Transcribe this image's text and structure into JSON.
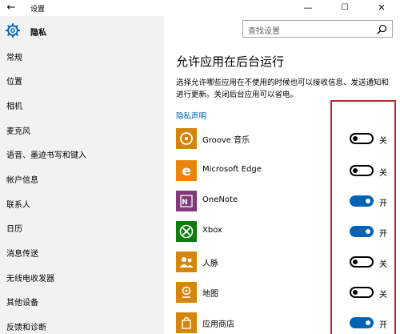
{
  "window": {
    "title": "设置",
    "back_icon": "back-arrow-icon"
  },
  "sidebar": {
    "header_label": "隐私",
    "items": [
      {
        "label": "常规"
      },
      {
        "label": "位置"
      },
      {
        "label": "相机"
      },
      {
        "label": "麦克风"
      },
      {
        "label": "语音、墨迹书写和键入"
      },
      {
        "label": "帐户信息"
      },
      {
        "label": "联系人"
      },
      {
        "label": "日历"
      },
      {
        "label": "消息传送"
      },
      {
        "label": "无线电收发器"
      },
      {
        "label": "其他设备"
      },
      {
        "label": "反馈和诊断"
      }
    ]
  },
  "search": {
    "placeholder": "查找设置"
  },
  "main": {
    "heading": "允许应用在后台运行",
    "description": "选择允许哪些应用在不使用的时候也可以接收信息、发送通知和进行更新。关闭后台应用可以省电。",
    "privacy_link": "隐私声明",
    "apps": [
      {
        "name": "Groove 音乐",
        "on": false,
        "state": "关",
        "icon": "groove-music-icon",
        "color": "#d4860b"
      },
      {
        "name": "Microsoft Edge",
        "on": false,
        "state": "关",
        "icon": "edge-icon",
        "color": "#e8860b"
      },
      {
        "name": "OneNote",
        "on": true,
        "state": "开",
        "icon": "onenote-icon",
        "color": "#80397b"
      },
      {
        "name": "Xbox",
        "on": true,
        "state": "开",
        "icon": "xbox-icon",
        "color": "#107c10"
      },
      {
        "name": "人脉",
        "on": false,
        "state": "关",
        "icon": "people-icon",
        "color": "#d4860b"
      },
      {
        "name": "地图",
        "on": false,
        "state": "关",
        "icon": "maps-icon",
        "color": "#d4860b"
      },
      {
        "name": "应用商店",
        "on": true,
        "state": "开",
        "icon": "store-icon",
        "color": "#d4860b"
      }
    ]
  },
  "colors": {
    "accent": "#0063b1",
    "highlight": "#c0272d",
    "sidebar_bg": "#f2f2f2"
  }
}
